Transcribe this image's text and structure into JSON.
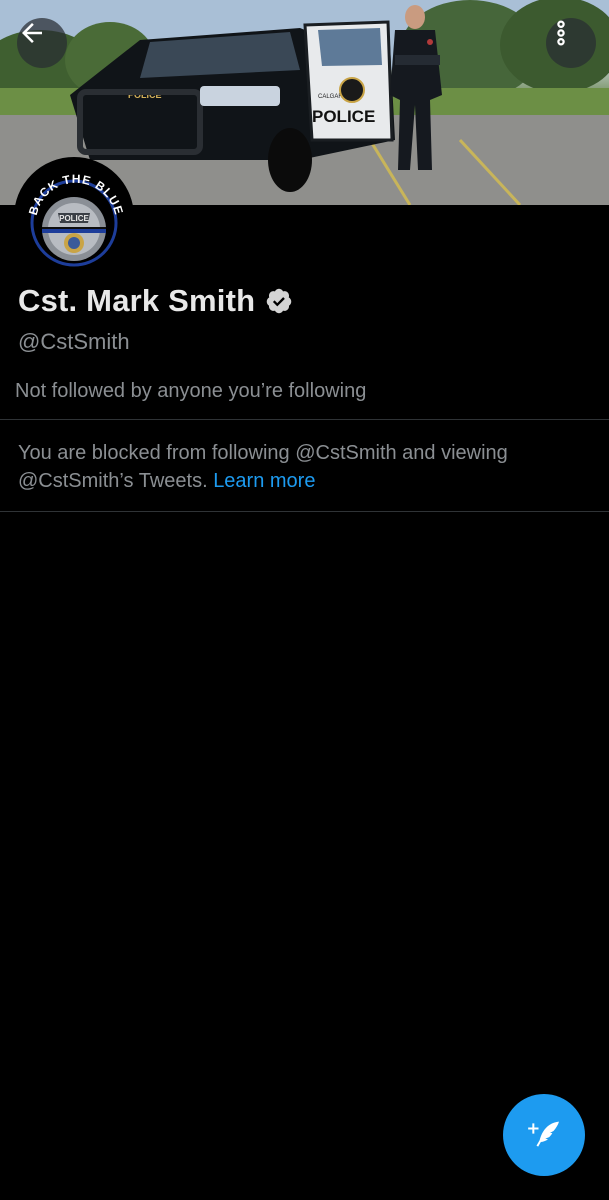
{
  "header": {
    "back_icon": "arrow-left-icon",
    "more_icon": "more-vertical-icon",
    "banner": {
      "car_door_text": "POLICE",
      "car_hood_text": "POLICE",
      "car_city_text": "CALGARY"
    }
  },
  "avatar": {
    "arc_text": "BACK THE BLUE",
    "badge_text": "POLICE"
  },
  "profile": {
    "display_name": "Cst. Mark Smith",
    "verified_icon": "verified-badge-icon",
    "handle": "@CstSmith",
    "followed_by_text": "Not followed by anyone you’re following"
  },
  "blocked_notice": {
    "text": "You are blocked from following @CstSmith and viewing @CstSmith’s Tweets.",
    "link_label": "Learn more"
  },
  "fab": {
    "icon": "compose-tweet-icon"
  },
  "colors": {
    "background": "#000000",
    "accent": "#1d9bf0",
    "secondary_text": "#8b8f93",
    "divider": "#2f3336"
  }
}
